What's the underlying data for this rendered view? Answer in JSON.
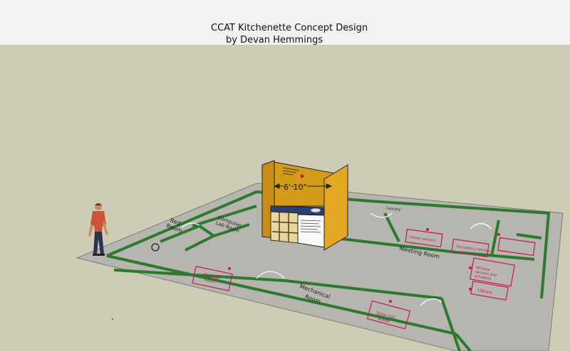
{
  "scene": {
    "title": "CCAT Kitchenette Concept Design",
    "subtitle": "by Devan Hemmings",
    "dimension_label": "6' 10\"",
    "room_labels": {
      "mechanical_room": "Mechanical\nRoom",
      "meeting_room": "Meeting Room",
      "red_room": "Red\nRoom",
      "computer_room": "Computer\nLab Room",
      "waiting_room": "Waiting\nroom",
      "solar_hot_water": "Solar hot\nwater",
      "library": "Library",
      "windows": "Window\nsensors and\nactuators",
      "occupancy": "Occupancy\nsensors",
      "outlets": "Outlet\nsensors",
      "laundry": "Laundry"
    },
    "colors": {
      "sky": "#f2f2f2",
      "ground": "#cfccb6",
      "floor": "#b8b7b2",
      "wall": "#2c7a2e",
      "cabinet": "#d9a21a",
      "countertop": "#2b3f73",
      "annotation": "#c61a4d"
    }
  }
}
